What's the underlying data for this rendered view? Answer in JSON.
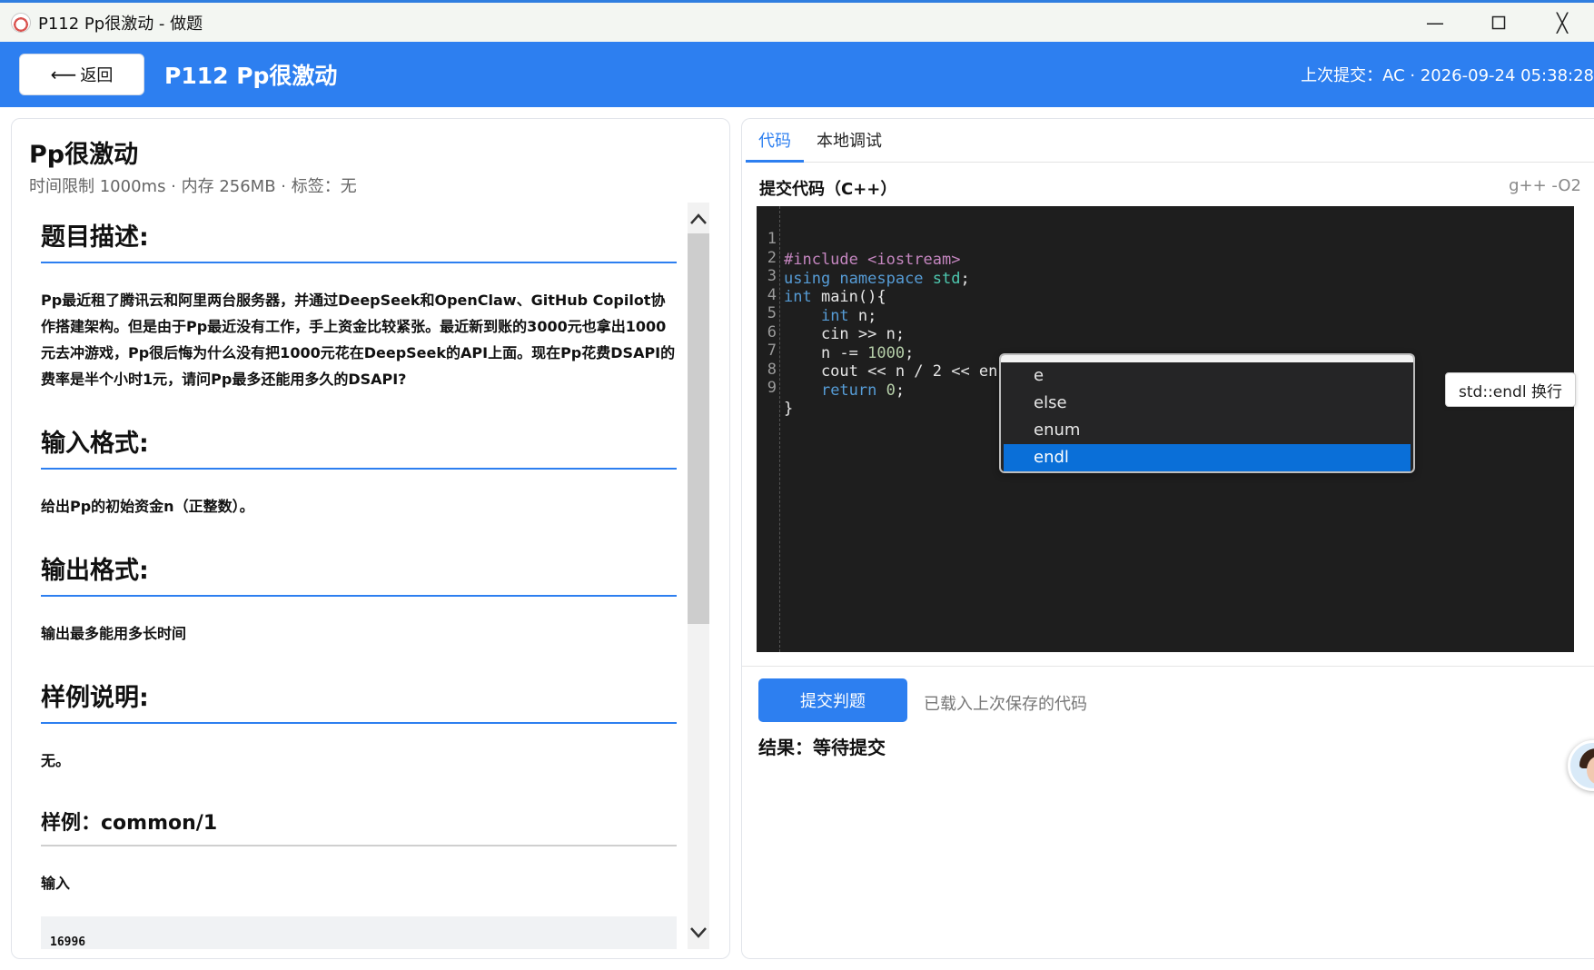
{
  "window": {
    "title": "P112 Pp很激动 - 做题",
    "minimize": "—",
    "close": "╳"
  },
  "header": {
    "back_label": "返回",
    "title": "P112 Pp很激动",
    "last_submit": "上次提交：AC · 2026-09-24 05:38:28"
  },
  "problem": {
    "title": "Pp很激动",
    "meta": "时间限制 1000ms · 内存 256MB · 标签：无",
    "sections": {
      "desc_heading": "题目描述:",
      "desc_text": "Pp最近租了腾讯云和阿里两台服务器，并通过DeepSeek和OpenClaw、GitHub Copilot协作搭建架构。但是由于Pp最近没有工作，手上资金比较紧张。最近新到账的3000元也拿出1000元去冲游戏，Pp很后悔为什么没有把1000元花在DeepSeek的API上面。现在Pp花费DSAPI的费率是半个小时1元，请问Pp最多还能用多久的DSAPI?",
      "input_heading": "输入格式:",
      "input_text": "给出Pp的初始资金n（正整数）。",
      "output_heading": "输出格式:",
      "output_text": "输出最多能用多长时间",
      "sample_heading": "样例说明:",
      "sample_text": "无。",
      "example_heading": "样例：common/1",
      "example_input_label": "输入",
      "example_input_value": "16996"
    }
  },
  "editor_panel": {
    "tabs": [
      "代码",
      "本地调试"
    ],
    "active_tab": 0,
    "code_label": "提交代码（C++）",
    "compiler": "g++ -O2",
    "line_numbers": [
      "1",
      "2",
      "3",
      "4",
      "5",
      "6",
      "7",
      "8",
      "9"
    ],
    "autocomplete": {
      "items": [
        "e",
        "else",
        "enum",
        "endl"
      ],
      "selected": 3,
      "tooltip": "std::endl 换行"
    },
    "submit_label": "提交判题",
    "loaded_hint": "已载入上次保存的代码",
    "result": "结果：等待提交"
  },
  "code": {
    "l1": "#include <iostream>",
    "l2a": "using",
    "l2b": " namespace ",
    "l2c": "std",
    "l2d": ";",
    "l3a": "int",
    "l3b": " main(){",
    "l4a": "    ",
    "l4b": "int",
    "l4c": " n;",
    "l5": "    cin >> n;",
    "l6a": "    n -= ",
    "l6b": "1000",
    "l6c": ";",
    "l7": "    cout << n / 2 << en",
    "l8a": "    ",
    "l8b": "return",
    "l8c": " ",
    "l8d": "0",
    "l8e": ";",
    "l9": "}"
  },
  "colors": {
    "accent": "#2d7ff0",
    "editor_bg": "#1e1e1e",
    "autocomplete_selected": "#0a6fd8"
  }
}
